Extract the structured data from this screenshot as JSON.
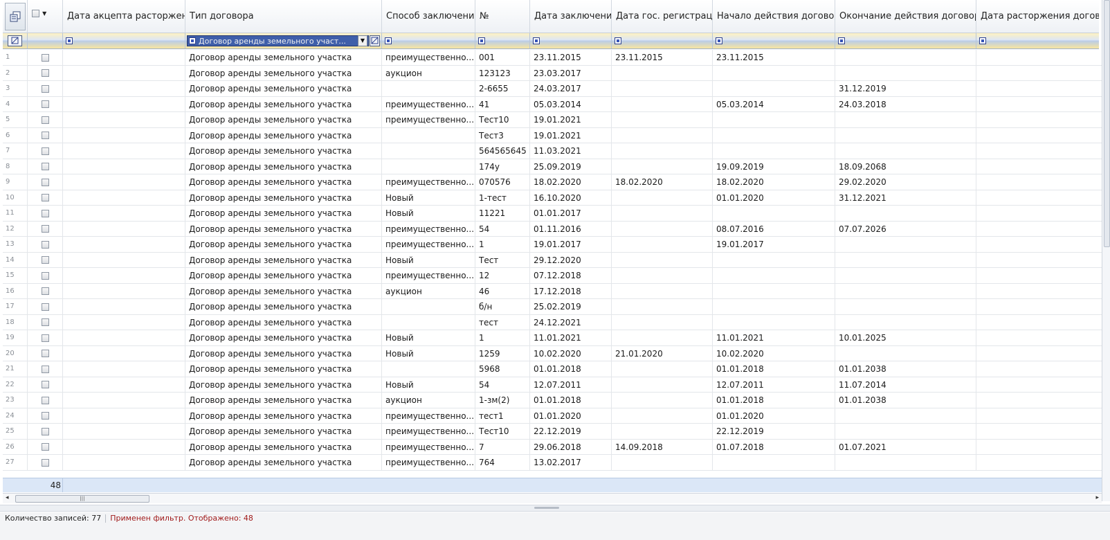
{
  "columns": [
    {
      "key": "accept",
      "label": "Дата акцепта расторжения"
    },
    {
      "key": "type",
      "label": "Тип договора"
    },
    {
      "key": "method",
      "label": "Способ заключения"
    },
    {
      "key": "no",
      "label": "№"
    },
    {
      "key": "date",
      "label": "Дата заключения"
    },
    {
      "key": "reg",
      "label": "Дата гос. регистрации"
    },
    {
      "key": "start",
      "label": "Начало действия договора"
    },
    {
      "key": "end",
      "label": "Окончание действия договора"
    },
    {
      "key": "term",
      "label": "Дата расторжения догов"
    }
  ],
  "filter": {
    "type_value": "Договор аренды земельного участ..."
  },
  "rows": [
    {
      "n": "1",
      "type": "Договор аренды земельного участка",
      "method": "преимущественно...",
      "no": "001",
      "date": "23.11.2015",
      "reg": "23.11.2015",
      "start": "23.11.2015",
      "end": ""
    },
    {
      "n": "2",
      "type": "Договор аренды земельного участка",
      "method": "аукцион",
      "no": "123123",
      "date": "23.03.2017",
      "reg": "",
      "start": "",
      "end": ""
    },
    {
      "n": "3",
      "type": "Договор аренды земельного участка",
      "method": "",
      "no": "2-6655",
      "date": "24.03.2017",
      "reg": "",
      "start": "",
      "end": "31.12.2019"
    },
    {
      "n": "4",
      "type": "Договор аренды земельного участка",
      "method": "преимущественно...",
      "no": "41",
      "date": "05.03.2014",
      "reg": "",
      "start": "05.03.2014",
      "end": "24.03.2018"
    },
    {
      "n": "5",
      "type": "Договор аренды земельного участка",
      "method": "преимущественно...",
      "no": "Тест10",
      "date": "19.01.2021",
      "reg": "",
      "start": "",
      "end": ""
    },
    {
      "n": "6",
      "type": "Договор аренды земельного участка",
      "method": "",
      "no": "Тест3",
      "date": "19.01.2021",
      "reg": "",
      "start": "",
      "end": ""
    },
    {
      "n": "7",
      "type": "Договор аренды земельного участка",
      "method": "",
      "no": "564565645",
      "date": "11.03.2021",
      "reg": "",
      "start": "",
      "end": ""
    },
    {
      "n": "8",
      "type": "Договор аренды земельного участка",
      "method": "",
      "no": "174у",
      "date": "25.09.2019",
      "reg": "",
      "start": "19.09.2019",
      "end": "18.09.2068"
    },
    {
      "n": "9",
      "type": "Договор аренды земельного участка",
      "method": "преимущественно...",
      "no": "070576",
      "date": "18.02.2020",
      "reg": "18.02.2020",
      "start": "18.02.2020",
      "end": "29.02.2020"
    },
    {
      "n": "10",
      "type": "Договор аренды земельного участка",
      "method": "Новый",
      "no": "1-тест",
      "date": "16.10.2020",
      "reg": "",
      "start": "01.01.2020",
      "end": "31.12.2021"
    },
    {
      "n": "11",
      "type": "Договор аренды земельного участка",
      "method": "Новый",
      "no": "11221",
      "date": "01.01.2017",
      "reg": "",
      "start": "",
      "end": ""
    },
    {
      "n": "12",
      "type": "Договор аренды земельного участка",
      "method": "преимущественно...",
      "no": "54",
      "date": "01.11.2016",
      "reg": "",
      "start": "08.07.2016",
      "end": "07.07.2026"
    },
    {
      "n": "13",
      "type": "Договор аренды земельного участка",
      "method": "преимущественно...",
      "no": "1",
      "date": "19.01.2017",
      "reg": "",
      "start": "19.01.2017",
      "end": ""
    },
    {
      "n": "14",
      "type": "Договор аренды земельного участка",
      "method": "Новый",
      "no": "Тест",
      "date": "29.12.2020",
      "reg": "",
      "start": "",
      "end": ""
    },
    {
      "n": "15",
      "type": "Договор аренды земельного участка",
      "method": "преимущественно...",
      "no": "12",
      "date": "07.12.2018",
      "reg": "",
      "start": "",
      "end": ""
    },
    {
      "n": "16",
      "type": "Договор аренды земельного участка",
      "method": "аукцион",
      "no": "46",
      "date": "17.12.2018",
      "reg": "",
      "start": "",
      "end": ""
    },
    {
      "n": "17",
      "type": "Договор аренды земельного участка",
      "method": "",
      "no": "б/н",
      "date": "25.02.2019",
      "reg": "",
      "start": "",
      "end": ""
    },
    {
      "n": "18",
      "type": "Договор аренды земельного участка",
      "method": "",
      "no": "тест",
      "date": "24.12.2021",
      "reg": "",
      "start": "",
      "end": ""
    },
    {
      "n": "19",
      "type": "Договор аренды земельного участка",
      "method": "Новый",
      "no": "1",
      "date": "11.01.2021",
      "reg": "",
      "start": "11.01.2021",
      "end": "10.01.2025"
    },
    {
      "n": "20",
      "type": "Договор аренды земельного участка",
      "method": "Новый",
      "no": "1259",
      "date": "10.02.2020",
      "reg": "21.01.2020",
      "start": "10.02.2020",
      "end": ""
    },
    {
      "n": "21",
      "type": "Договор аренды земельного участка",
      "method": "",
      "no": "5968",
      "date": "01.01.2018",
      "reg": "",
      "start": "01.01.2018",
      "end": "01.01.2038"
    },
    {
      "n": "22",
      "type": "Договор аренды земельного участка",
      "method": "Новый",
      "no": "54",
      "date": "12.07.2011",
      "reg": "",
      "start": "12.07.2011",
      "end": "11.07.2014"
    },
    {
      "n": "23",
      "type": "Договор аренды земельного участка",
      "method": "аукцион",
      "no": "1-зм(2)",
      "date": "01.01.2018",
      "reg": "",
      "start": "01.01.2018",
      "end": "01.01.2038"
    },
    {
      "n": "24",
      "type": "Договор аренды земельного участка",
      "method": "преимущественно...",
      "no": "тест1",
      "date": "01.01.2020",
      "reg": "",
      "start": "01.01.2020",
      "end": ""
    },
    {
      "n": "25",
      "type": "Договор аренды земельного участка",
      "method": "преимущественно...",
      "no": "Тест10",
      "date": "22.12.2019",
      "reg": "",
      "start": "22.12.2019",
      "end": ""
    },
    {
      "n": "26",
      "type": "Договор аренды земельного участка",
      "method": "преимущественно...",
      "no": "7",
      "date": "29.06.2018",
      "reg": "14.09.2018",
      "start": "01.07.2018",
      "end": "01.07.2021"
    },
    {
      "n": "27",
      "type": "Договор аренды земельного участка",
      "method": "преимущественно...",
      "no": "764",
      "date": "13.02.2017",
      "reg": "",
      "start": "",
      "end": ""
    }
  ],
  "footer": {
    "count": "48"
  },
  "status": {
    "records": "Количество записей: 77",
    "filter": "Применен фильтр. Отображено: 48"
  },
  "icons": {
    "corner": "column-chooser-icon",
    "filter_clear": "filter-clear-icon"
  }
}
